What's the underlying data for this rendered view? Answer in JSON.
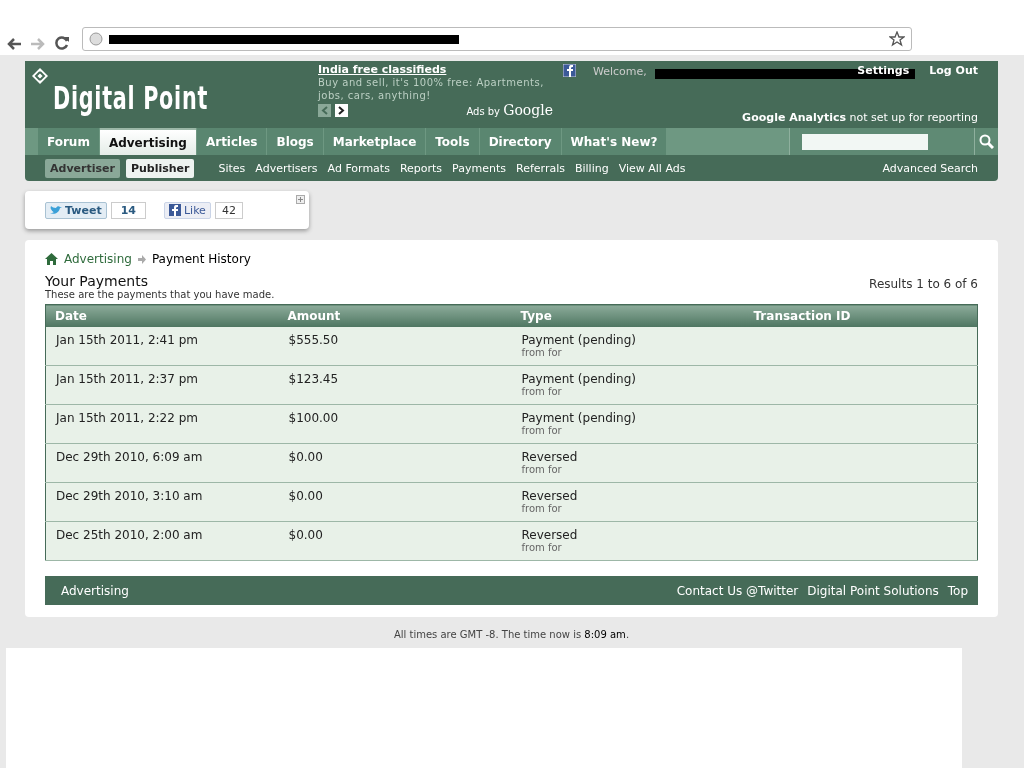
{
  "header": {
    "logo": "Digital Point",
    "ad": {
      "title": "India free classifieds",
      "text": "Buy and sell, it's 100% free: Apartments, jobs, cars, anything!",
      "ads_by": "Ads by",
      "google": "Google"
    },
    "welcome": "Welcome,",
    "links": [
      "Settings",
      "Log Out"
    ],
    "analytics": "**Google Analytics** not set up for reporting"
  },
  "nav_tabs": [
    {
      "label": "Forum",
      "selected": false
    },
    {
      "label": "Advertising",
      "selected": true
    },
    {
      "label": "Articles",
      "selected": false
    },
    {
      "label": "Blogs",
      "selected": false
    },
    {
      "label": "Marketplace",
      "selected": false
    },
    {
      "label": "Tools",
      "selected": false
    },
    {
      "label": "Directory",
      "selected": false
    },
    {
      "label": "What's New?",
      "selected": false
    }
  ],
  "sub_nav": {
    "toggles": [
      {
        "label": "Advertiser",
        "selected": true
      },
      {
        "label": "Publisher",
        "selected": false
      }
    ],
    "links": [
      "Sites",
      "Advertisers",
      "Ad Formats",
      "Reports",
      "Payments",
      "Referrals",
      "Billing",
      "View All Ads"
    ],
    "advanced_search": "Advanced Search"
  },
  "social": {
    "tweet": "Tweet",
    "tweet_count": "14",
    "like": "Like",
    "like_count": "42"
  },
  "breadcrumb": {
    "parent": "Advertising",
    "current": "Payment History"
  },
  "title": "Your Payments",
  "subtitle": "These are the payments that you have made.",
  "results": "Results 1 to 6 of 6",
  "table": {
    "columns": [
      "Date",
      "Amount",
      "Type",
      "Transaction ID"
    ],
    "rows": [
      {
        "date": "Jan 15th 2011, 2:41 pm",
        "amount": "$555.50",
        "type": "Payment (pending)",
        "note": "from for"
      },
      {
        "date": "Jan 15th 2011, 2:37 pm",
        "amount": "$123.45",
        "type": "Payment (pending)",
        "note": "from for"
      },
      {
        "date": "Jan 15th 2011, 2:22 pm",
        "amount": "$100.00",
        "type": "Payment (pending)",
        "note": "from for"
      },
      {
        "date": "Dec 29th 2010, 6:09 am",
        "amount": "$0.00",
        "type": "Reversed",
        "note": "from for"
      },
      {
        "date": "Dec 29th 2010, 3:10 am",
        "amount": "$0.00",
        "type": "Reversed",
        "note": "from for"
      },
      {
        "date": "Dec 25th 2010, 2:00 am",
        "amount": "$0.00",
        "type": "Reversed",
        "note": "from for"
      }
    ]
  },
  "footer": {
    "left": "Advertising",
    "links": [
      "Contact Us @Twitter",
      "Digital Point Solutions",
      "Top"
    ]
  },
  "timezone": "All times are GMT -8. The time now is **8:09 am**."
}
